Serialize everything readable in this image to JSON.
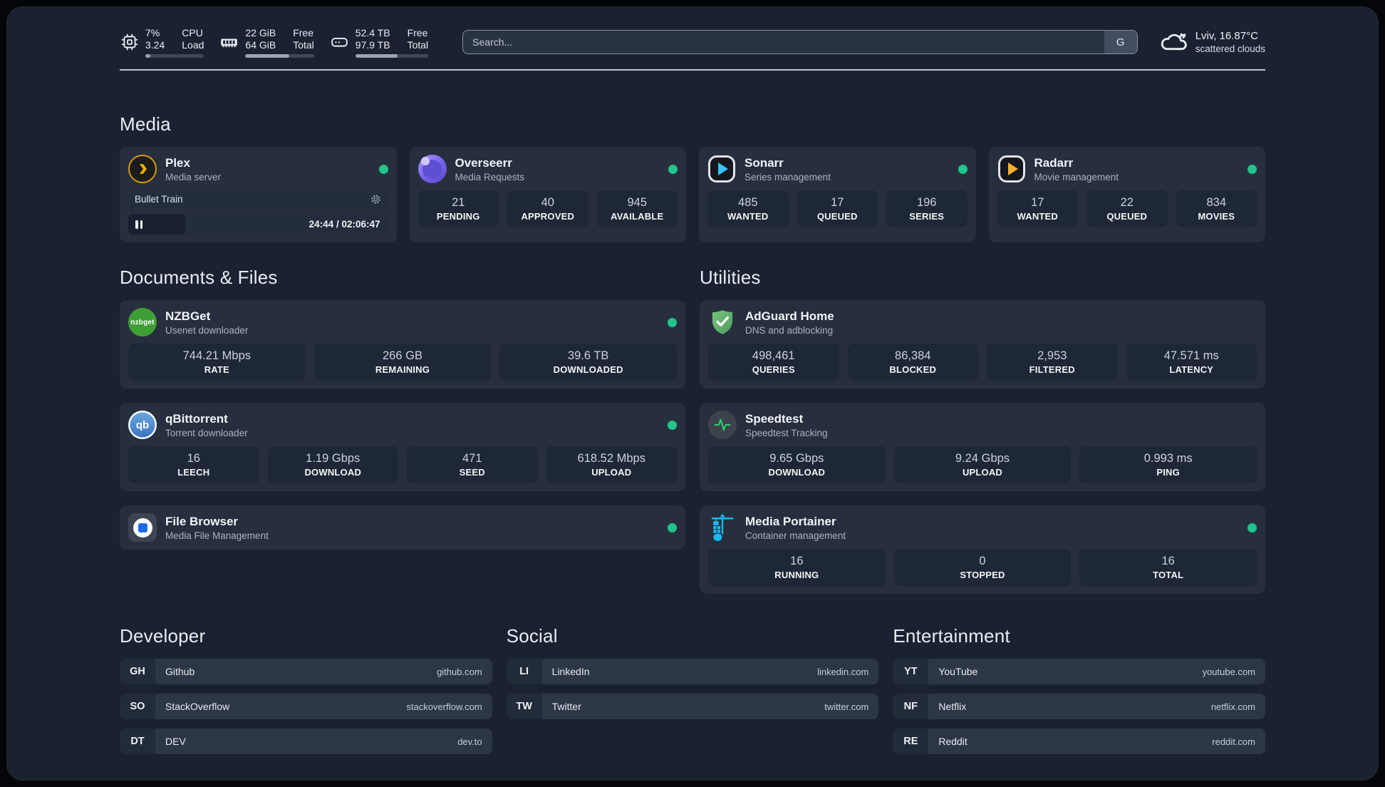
{
  "header": {
    "system_stats": [
      {
        "icon": "cpu-icon",
        "values": [
          "7%",
          "3.24"
        ],
        "labels": [
          "CPU",
          "Load"
        ],
        "progress": "9%"
      },
      {
        "icon": "memory-icon",
        "values": [
          "22 GiB",
          "64 GiB"
        ],
        "labels": [
          "Free",
          "Total"
        ],
        "progress": "64%"
      },
      {
        "icon": "storage-icon",
        "values": [
          "52.4 TB",
          "97.9 TB"
        ],
        "labels": [
          "Free",
          "Total"
        ],
        "progress": "58%"
      }
    ],
    "search": {
      "placeholder": "Search...",
      "engine_button": "G"
    },
    "weather": {
      "icon": "cloud-icon",
      "headline": "Lviv, 16.87°C",
      "condition": "scattered clouds"
    }
  },
  "media": {
    "section_title": "Media",
    "plex": {
      "icon": "plex-icon",
      "name": "Plex",
      "subtitle": "Media server",
      "now_playing": "Bullet Train",
      "elapsed": "24:44 / 02:06:47",
      "progress": "22%"
    },
    "overseerr": {
      "icon": "overseerr-icon",
      "name": "Overseerr",
      "subtitle": "Media Requests",
      "stats": [
        {
          "value": "21",
          "label": "PENDING"
        },
        {
          "value": "40",
          "label": "APPROVED"
        },
        {
          "value": "945",
          "label": "AVAILABLE"
        }
      ]
    },
    "sonarr": {
      "icon": "sonarr-icon",
      "name": "Sonarr",
      "subtitle": "Series management",
      "stats": [
        {
          "value": "485",
          "label": "WANTED"
        },
        {
          "value": "17",
          "label": "QUEUED"
        },
        {
          "value": "196",
          "label": "SERIES"
        }
      ]
    },
    "radarr": {
      "icon": "radarr-icon",
      "name": "Radarr",
      "subtitle": "Movie management",
      "stats": [
        {
          "value": "17",
          "label": "WANTED"
        },
        {
          "value": "22",
          "label": "QUEUED"
        },
        {
          "value": "834",
          "label": "MOVIES"
        }
      ]
    }
  },
  "documents": {
    "section_title": "Documents & Files",
    "nzbget": {
      "icon": "nzbget-icon",
      "name": "NZBGet",
      "subtitle": "Usenet downloader",
      "stats": [
        {
          "value": "744.21 Mbps",
          "label": "RATE"
        },
        {
          "value": "266 GB",
          "label": "REMAINING"
        },
        {
          "value": "39.6 TB",
          "label": "DOWNLOADED"
        }
      ]
    },
    "qbittorrent": {
      "icon": "qbittorrent-icon",
      "name": "qBittorrent",
      "subtitle": "Torrent downloader",
      "stats": [
        {
          "value": "16",
          "label": "LEECH"
        },
        {
          "value": "1.19 Gbps",
          "label": "DOWNLOAD"
        },
        {
          "value": "471",
          "label": "SEED"
        },
        {
          "value": "618.52 Mbps",
          "label": "UPLOAD"
        }
      ]
    },
    "filebrowser": {
      "icon": "filebrowser-icon",
      "name": "File Browser",
      "subtitle": "Media File Management"
    }
  },
  "utilities": {
    "section_title": "Utilities",
    "adguard": {
      "icon": "adguard-shield-icon",
      "name": "AdGuard Home",
      "subtitle": "DNS and adblocking",
      "stats": [
        {
          "value": "498,461",
          "label": "QUERIES"
        },
        {
          "value": "86,384",
          "label": "BLOCKED"
        },
        {
          "value": "2,953",
          "label": "FILTERED"
        },
        {
          "value": "47.571 ms",
          "label": "LATENCY"
        }
      ]
    },
    "speedtest": {
      "icon": "speedtest-pulse-icon",
      "name": "Speedtest",
      "subtitle": "Speedtest Tracking",
      "stats": [
        {
          "value": "9.65 Gbps",
          "label": "DOWNLOAD"
        },
        {
          "value": "9.24 Gbps",
          "label": "UPLOAD"
        },
        {
          "value": "0.993 ms",
          "label": "PING"
        }
      ]
    },
    "portainer": {
      "icon": "portainer-crane-icon",
      "name": "Media Portainer",
      "subtitle": "Container management",
      "stats": [
        {
          "value": "16",
          "label": "RUNNING"
        },
        {
          "value": "0",
          "label": "STOPPED"
        },
        {
          "value": "16",
          "label": "TOTAL"
        }
      ]
    }
  },
  "bookmarks": {
    "developer": {
      "section_title": "Developer",
      "items": [
        {
          "abbr": "GH",
          "name": "Github",
          "url": "github.com"
        },
        {
          "abbr": "SO",
          "name": "StackOverflow",
          "url": "stackoverflow.com"
        },
        {
          "abbr": "DT",
          "name": "DEV",
          "url": "dev.to"
        }
      ]
    },
    "social": {
      "section_title": "Social",
      "items": [
        {
          "abbr": "LI",
          "name": "LinkedIn",
          "url": "linkedin.com"
        },
        {
          "abbr": "TW",
          "name": "Twitter",
          "url": "twitter.com"
        }
      ]
    },
    "entertainment": {
      "section_title": "Entertainment",
      "items": [
        {
          "abbr": "YT",
          "name": "YouTube",
          "url": "youtube.com"
        },
        {
          "abbr": "NF",
          "name": "Netflix",
          "url": "netflix.com"
        },
        {
          "abbr": "RE",
          "name": "Reddit",
          "url": "reddit.com"
        }
      ]
    }
  },
  "colors": {
    "status_online": "#21c48b",
    "page_bg": "#1a2232",
    "card_bg": "#272f3e",
    "tile_bg": "#1e2736",
    "accent_blue": "#19b9f2"
  }
}
